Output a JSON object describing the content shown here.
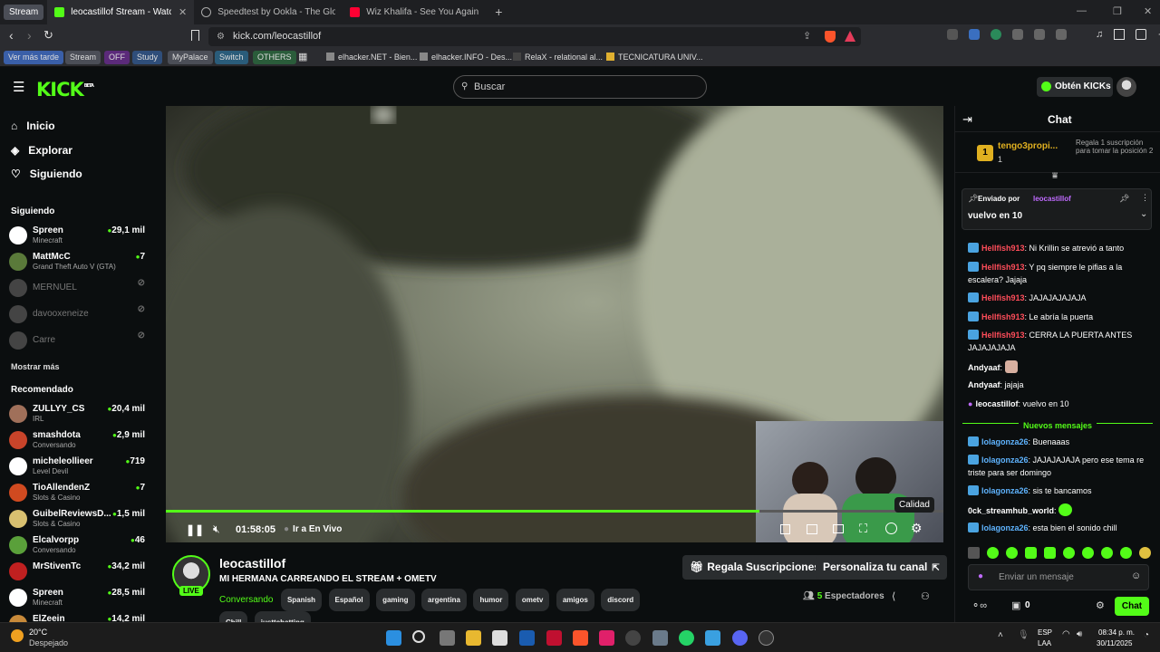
{
  "browser": {
    "tabs": [
      {
        "label": "Stream",
        "type": "group"
      },
      {
        "label": "leocastillof Stream - Watch Live",
        "active": true,
        "color": "#53fc18"
      },
      {
        "label": "Speedtest by Ookla - The Global Bro",
        "color": "#888888"
      },
      {
        "label": "Wiz Khalifa - See You Again ft. Charli",
        "color": "#ff0033"
      }
    ],
    "new_tab": "+",
    "url": "kick.com/leocastillof",
    "bookmarks": [
      {
        "label": "Ver más tarde",
        "color": "#3a5fa8"
      },
      {
        "label": "Stream",
        "color": "#4b4e57"
      },
      {
        "label": "OFF",
        "color": "#5b2a7a"
      },
      {
        "label": "Study",
        "color": "#2f4e7a"
      },
      {
        "label": "MyPalace",
        "color": "#4b4e57"
      },
      {
        "label": "Switch",
        "color": "#2a5c7a"
      },
      {
        "label": "OTHERS",
        "color": "#2a5c3a"
      },
      {
        "label": "elhacker.NET - Bien..."
      },
      {
        "label": "elhacker.INFO - Des..."
      },
      {
        "label": "RelaX - relational al..."
      },
      {
        "label": "TECNICATURA UNIV..."
      }
    ]
  },
  "kick": {
    "logo": "KICK",
    "logo_beta": "BETA",
    "search_placeholder": "Buscar",
    "get_kicks": "Obtén KICKs",
    "accent": "#53fc18"
  },
  "sidebar": {
    "nav": [
      "Inicio",
      "Explorar",
      "Siguiendo"
    ],
    "following_title": "Siguiendo",
    "following": [
      {
        "name": "Spreen",
        "category": "Minecraft",
        "viewers": "29,1 mil",
        "color": "#ffffff"
      },
      {
        "name": "MattMcC",
        "category": "Grand Theft Auto V (GTA)",
        "viewers": "7",
        "color": "#5a7a3a"
      },
      {
        "name": "MERNUEL",
        "offline": true,
        "color": "#555555"
      },
      {
        "name": "davooxeneize",
        "offline": true,
        "color": "#555555"
      },
      {
        "name": "Carre",
        "offline": true,
        "color": "#555555"
      }
    ],
    "show_more": "Mostrar más",
    "recommended_title": "Recomendado",
    "recommended": [
      {
        "name": "ZULLYY_CS",
        "category": "IRL",
        "viewers": "20,4 mil",
        "color": "#a0705a"
      },
      {
        "name": "smashdota",
        "category": "Conversando",
        "viewers": "2,9 mil",
        "color": "#c8442a"
      },
      {
        "name": "micheleollieer",
        "category": "Level Devil",
        "viewers": "719",
        "color": "#ffffff"
      },
      {
        "name": "TioAllendenZ",
        "category": "Slots & Casino",
        "viewers": "7",
        "color": "#d04a20"
      },
      {
        "name": "GuibelReviewsD...",
        "category": "Slots & Casino",
        "viewers": "1,5 mil",
        "color": "#d8c070"
      },
      {
        "name": "Elcalvorpp",
        "category": "Conversando",
        "viewers": "46",
        "color": "#5aa03a"
      },
      {
        "name": "MrStivenTc",
        "category": "",
        "viewers": "34,2 mil",
        "color": "#c02020"
      },
      {
        "name": "Spreen",
        "category": "Minecraft",
        "viewers": "28,5 mil",
        "color": "#ffffff"
      },
      {
        "name": "ElZeein",
        "category": "",
        "viewers": "14,2 mil",
        "color": "#c88a3a"
      }
    ]
  },
  "player": {
    "time": "01:58:05",
    "go_live": "Ir a En Vivo",
    "tooltip": "Calidad",
    "progress": 0.763
  },
  "stream": {
    "channel": "leocastillof",
    "live_badge": "LIVE",
    "title": "MI HERMANA CARREANDO EL STREAM + OMETV",
    "category": "Conversando",
    "tags": [
      "Spanish",
      "Español",
      "gaming",
      "argentina",
      "humor",
      "ometv",
      "amigos",
      "discord",
      "Chill",
      "justtchatting"
    ],
    "gift_subs": "Regala Suscripciones",
    "customize": "Personaliza tu canal",
    "viewers_count": "5",
    "viewers_label": "Espectadores"
  },
  "chat": {
    "title": "Chat",
    "top_gifter": {
      "name": "tengo3propi...",
      "rank": "1",
      "count": "1",
      "note": "Regala 1 suscripción para tomar la posición 2"
    },
    "pinned": {
      "label": "Enviado por",
      "user": "leocastillof",
      "text": "vuelvo en 10"
    },
    "messages": [
      {
        "user": "Hellfish913",
        "text": "Ni Krillin se atrevió a tanto",
        "color": "red",
        "badge": true
      },
      {
        "user": "Hellfish913",
        "text": "Y pq siempre le pifias a la escalera? Jajaja",
        "color": "red",
        "badge": true
      },
      {
        "user": "Hellfish913",
        "text": "JAJAJAJAJAJA",
        "color": "red",
        "badge": true
      },
      {
        "user": "Hellfish913",
        "text": "Le abría la puerta",
        "color": "red",
        "badge": true
      },
      {
        "user": "Hellfish913",
        "text": "CERRA LA PUERTA ANTES JAJAJAJAJA",
        "color": "red",
        "badge": true
      },
      {
        "user": "Andyaaf",
        "text": "",
        "color": "plain",
        "badge": false
      },
      {
        "user": "Andyaaf",
        "text": "jajaja",
        "color": "plain",
        "badge": false
      },
      {
        "user": "leocastillof",
        "text": "vuelvo en 10",
        "color": "plain",
        "badge": false
      }
    ],
    "new_messages": "Nuevos mensajes",
    "new": [
      {
        "user": "lolagonza26",
        "text": "Buenaaas",
        "color": "blu"
      },
      {
        "user": "lolagonza26",
        "text": "JAJAJAJAJA pero ese tema re triste para ser domingo",
        "color": "blu"
      },
      {
        "user": "lolagonza26",
        "text": "sis te bancamos",
        "color": "blu"
      },
      {
        "user": "0ck_streamhub_world",
        "text": "",
        "color": "plain"
      },
      {
        "user": "lolagonza26",
        "text": "esta bien el sonido chill",
        "color": "blu"
      }
    ],
    "input_placeholder": "Enviar un mensaje",
    "points": "0",
    "send": "Chat"
  },
  "taskbar": {
    "temp": "20°C",
    "weather": "Despejado",
    "lang": "ESP",
    "lang2": "LAA",
    "time": "08:34 p. m.",
    "date": "30/11/2025"
  }
}
